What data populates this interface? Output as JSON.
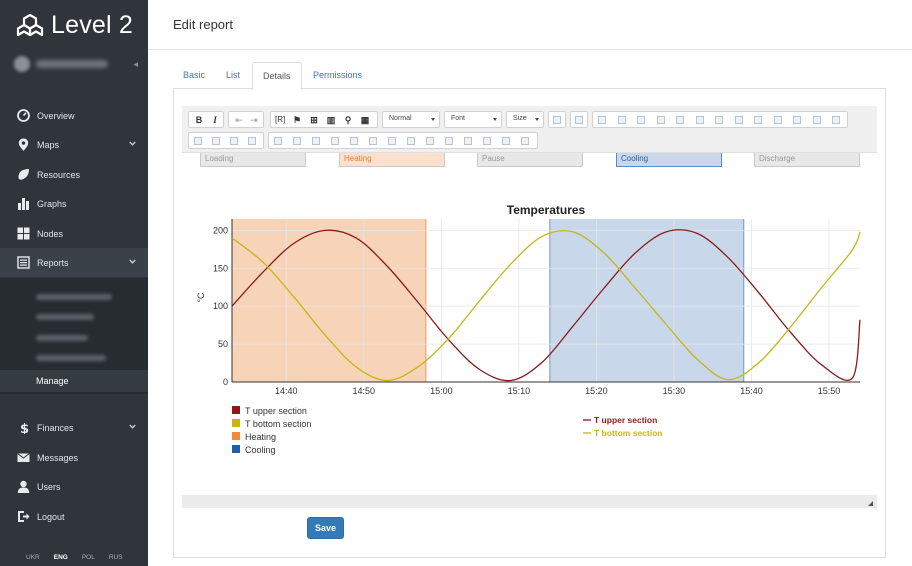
{
  "app": {
    "title": "Level 2"
  },
  "sidebar": {
    "items": [
      {
        "label": "Overview",
        "icon": "dashboard-icon"
      },
      {
        "label": "Maps",
        "icon": "map-marker-icon",
        "has_chevron": true
      },
      {
        "label": "Resources",
        "icon": "leaf-icon"
      },
      {
        "label": "Graphs",
        "icon": "bar-chart-icon"
      },
      {
        "label": "Nodes",
        "icon": "grid-icon"
      },
      {
        "label": "Reports",
        "icon": "report-icon",
        "has_chevron": true,
        "active": true
      },
      {
        "label": "Finances",
        "icon": "dollar-icon",
        "has_chevron": true
      },
      {
        "label": "Messages",
        "icon": "envelope-icon"
      },
      {
        "label": "Users",
        "icon": "user-icon"
      },
      {
        "label": "Logout",
        "icon": "sign-out-icon"
      }
    ],
    "reports_submenu_active": "Manage",
    "languages": [
      "UKR",
      "ENG",
      "POL",
      "RUS"
    ],
    "active_language": "ENG"
  },
  "header": {
    "title": "Edit report"
  },
  "tabs": [
    {
      "label": "Basic"
    },
    {
      "label": "List"
    },
    {
      "label": "Details",
      "active": true
    },
    {
      "label": "Permissions"
    }
  ],
  "toolbar": {
    "format_select": "Normal",
    "font_select": "Font",
    "size_select": "Size"
  },
  "editor": {
    "states": [
      "Loading",
      "Heating",
      "Pause",
      "Cooling",
      "Discharge"
    ]
  },
  "chart_data": {
    "type": "line",
    "title": "Temperatures",
    "ylabel": "°C",
    "xlabel": "",
    "x_ticks": [
      "14:40",
      "14:50",
      "15:00",
      "15:10",
      "15:20",
      "15:30",
      "15:40",
      "15:50"
    ],
    "y_ticks": [
      0,
      50,
      100,
      150,
      200
    ],
    "ylim": [
      0,
      215
    ],
    "xlim": [
      "14:33",
      "15:54"
    ],
    "grid": true,
    "bands": [
      {
        "name": "Heating",
        "from": "14:33",
        "to": "14:58",
        "color": "#f7d3b8"
      },
      {
        "name": "Cooling",
        "from": "15:14",
        "to": "15:39",
        "color": "#c8d8ea"
      }
    ],
    "series": [
      {
        "name": "T upper section",
        "color": "#8b1a1a",
        "x": [
          "14:33",
          "14:37",
          "14:41",
          "14:45",
          "14:49",
          "14:53",
          "14:57",
          "15:01",
          "15:05",
          "15:09",
          "15:13",
          "15:17",
          "15:21",
          "15:25",
          "15:29",
          "15:33",
          "15:37",
          "15:41",
          "15:45",
          "15:49",
          "15:53",
          "15:54"
        ],
        "y": [
          100,
          145,
          183,
          200,
          190,
          153,
          105,
          55,
          16,
          2,
          26,
          74,
          124,
          170,
          198,
          196,
          164,
          117,
          66,
          23,
          5,
          82
        ]
      },
      {
        "name": "T bottom section",
        "color": "#c8b416",
        "x": [
          "14:33",
          "14:37",
          "14:41",
          "14:45",
          "14:49",
          "14:53",
          "14:57",
          "15:01",
          "15:05",
          "15:09",
          "15:13",
          "15:17",
          "15:21",
          "15:25",
          "15:29",
          "15:33",
          "15:37",
          "15:41",
          "15:45",
          "15:49",
          "15:53",
          "15:54"
        ],
        "y": [
          190,
          158,
          112,
          62,
          20,
          2,
          20,
          58,
          108,
          156,
          192,
          198,
          170,
          124,
          76,
          30,
          3,
          26,
          72,
          124,
          174,
          198
        ]
      }
    ],
    "legend_left": [
      "T upper section",
      "T bottom section",
      "Heating",
      "Cooling"
    ],
    "legend_left_colors": [
      "#8b1a1a",
      "#c8b416",
      "#f08a3c",
      "#1f5fa8"
    ],
    "legend_right": [
      "T upper section",
      "T bottom section"
    ]
  },
  "form": {
    "save_label": "Save"
  },
  "colors": {
    "sidebar_bg": "#2f353b",
    "accent": "#337ab7",
    "heating": "#f7d3b8",
    "cooling": "#c8d8ea"
  }
}
